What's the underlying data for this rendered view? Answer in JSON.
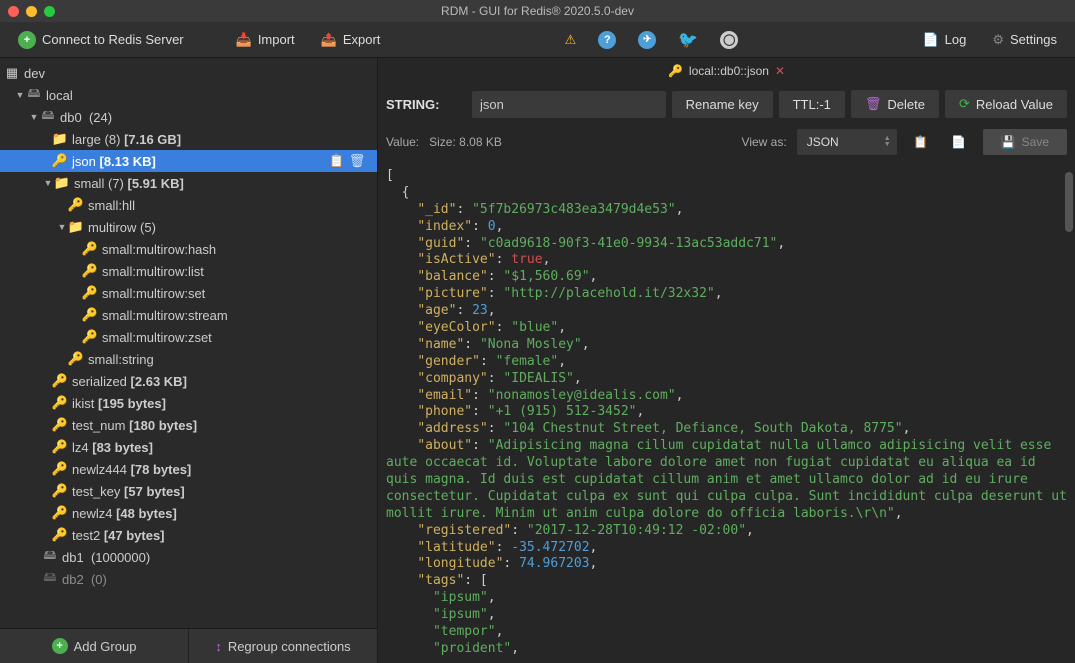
{
  "window_title": "RDM - GUI for Redis® 2020.5.0-dev",
  "toolbar": {
    "connect": "Connect to Redis Server",
    "import": "Import",
    "export": "Export",
    "log": "Log",
    "settings": "Settings"
  },
  "sidebar": {
    "root": "dev",
    "server": "local",
    "db0": {
      "label": "db0",
      "count": "(24)"
    },
    "large": {
      "label": "large",
      "count": "(8)",
      "size": "[7.16 GB]"
    },
    "json": {
      "label": "json",
      "size": "[8.13 KB]"
    },
    "small": {
      "label": "small",
      "count": "(7)",
      "size": "[5.91 KB]"
    },
    "small_hll": "small:hll",
    "multirow": {
      "label": "multirow",
      "count": "(5)"
    },
    "mr_hash": "small:multirow:hash",
    "mr_list": "small:multirow:list",
    "mr_set": "small:multirow:set",
    "mr_stream": "small:multirow:stream",
    "mr_zset": "small:multirow:zset",
    "small_string": "small:string",
    "serialized": {
      "label": "serialized",
      "size": "[2.63 KB]"
    },
    "ikist": {
      "label": "ikist",
      "size": "[195 bytes]"
    },
    "test_num": {
      "label": "test_num",
      "size": "[180 bytes]"
    },
    "lz4": {
      "label": "lz4",
      "size": "[83 bytes]"
    },
    "newlz444": {
      "label": "newlz444",
      "size": "[78 bytes]"
    },
    "test_key": {
      "label": "test_key",
      "size": "[57 bytes]"
    },
    "newlz4": {
      "label": "newlz4",
      "size": "[48 bytes]"
    },
    "test2": {
      "label": "test2",
      "size": "[47 bytes]"
    },
    "db1": {
      "label": "db1",
      "count": "(1000000)"
    },
    "db2": {
      "label": "db2",
      "count": "(0)"
    },
    "add_group": "Add Group",
    "regroup": "Regroup connections"
  },
  "crumb": "local::db0::json",
  "type_label": "STRING:",
  "key_value": "json",
  "rename": "Rename key",
  "ttl": "TTL:-1",
  "delete": "Delete",
  "reload": "Reload Value",
  "value_label": "Value:",
  "size_label": "Size: 8.08 KB",
  "viewas_label": "View as:",
  "viewas_value": "JSON",
  "save": "Save",
  "json_content": {
    "_id": "5f7b26973c483ea3479d4e53",
    "index": 0,
    "guid": "c0ad9618-90f3-41e0-9934-13ac53addc71",
    "isActive": true,
    "balance": "$1,560.69",
    "picture": "http://placehold.it/32x32",
    "age": 23,
    "eyeColor": "blue",
    "name": "Nona Mosley",
    "gender": "female",
    "company": "IDEALIS",
    "email": "nonamosley@idealis.com",
    "phone": "+1 (915) 512-3452",
    "address": "104 Chestnut Street, Defiance, South Dakota, 8775",
    "about": "Adipisicing magna cillum cupidatat nulla ullamco adipisicing velit esse aute occaecat id. Voluptate labore dolore amet non fugiat cupidatat eu aliqua ea id quis magna. Id duis est cupidatat cillum anim et amet ullamco dolor ad id eu irure consectetur. Cupidatat culpa ex sunt qui culpa culpa. Sunt incididunt culpa deserunt ut mollit irure. Minim ut anim culpa dolore do officia laboris.\\r\\n",
    "registered": "2017-12-28T10:49:12 -02:00",
    "latitude": -35.472702,
    "longitude": 74.967203,
    "tags": [
      "ipsum",
      "ipsum",
      "tempor",
      "proident"
    ]
  }
}
